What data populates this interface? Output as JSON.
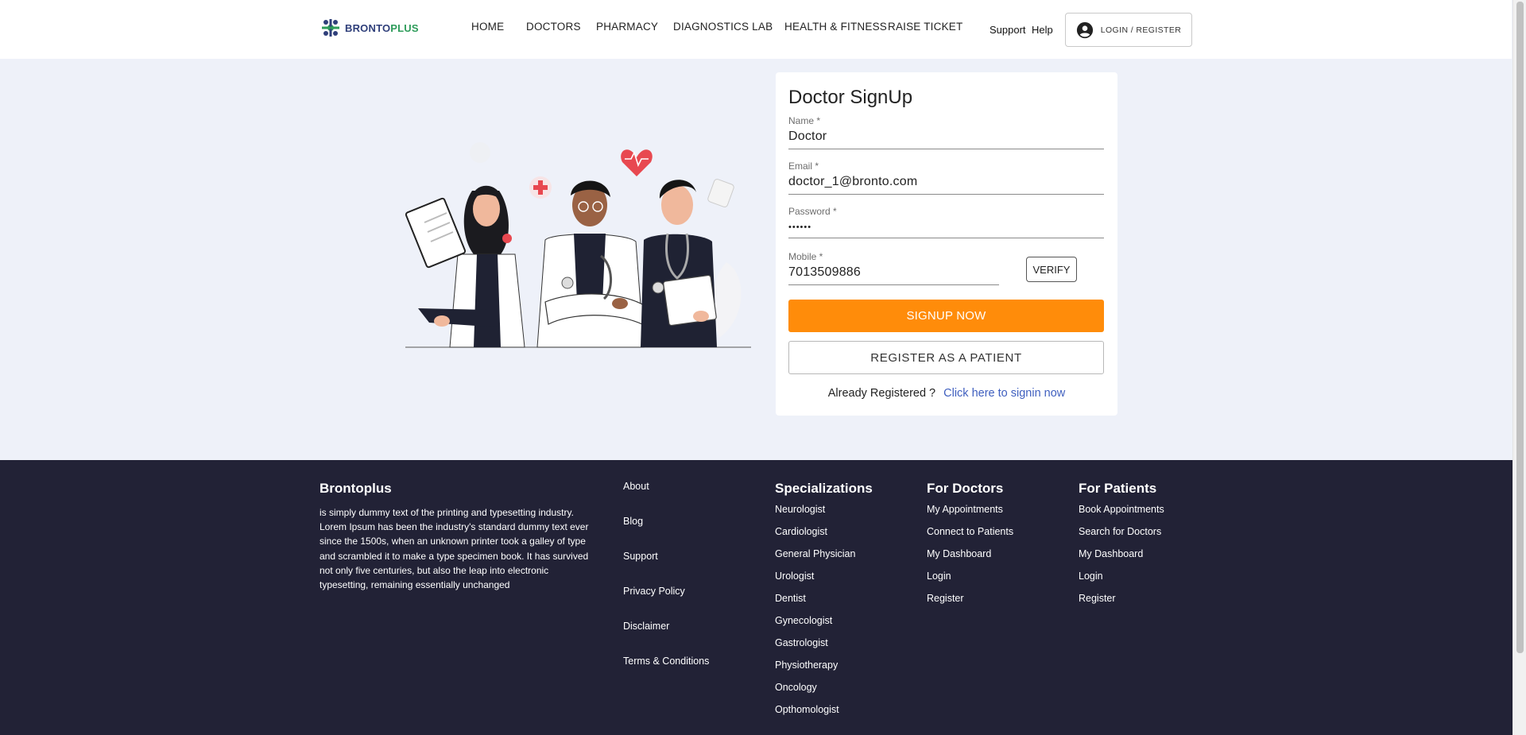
{
  "brand": {
    "part1": "BRONTO",
    "part2": "PLUS"
  },
  "nav": [
    "HOME",
    "DOCTORS",
    "PHARMACY",
    "DIAGNOSTICS LAB",
    "HEALTH & FITNESS",
    "RAISE TICKET"
  ],
  "top_links": {
    "support": "Support",
    "help": "Help"
  },
  "login_label": "LOGIN / REGISTER",
  "form": {
    "title": "Doctor SignUp",
    "name": {
      "label": "Name *",
      "value": "Doctor"
    },
    "email": {
      "label": "Email *",
      "value": "doctor_1@bronto.com"
    },
    "password": {
      "label": "Password *",
      "value": "••••••"
    },
    "mobile": {
      "label": "Mobile *",
      "value": "7013509886"
    },
    "verify_label": "VERIFY",
    "signup_label": "SIGNUP NOW",
    "patient_label": "REGISTER AS A PATIENT",
    "already_text": "Already Registered ?",
    "signin_link": "Click here to signin now"
  },
  "footer": {
    "brand": "Brontoplus",
    "description": "is simply dummy text of the printing and typesetting industry. Lorem Ipsum has been the industry's standard dummy text ever since the 1500s, when an unknown printer took a galley of type and scrambled it to make a type specimen book. It has survived not only five centuries, but also the leap into electronic typesetting, remaining essentially unchanged",
    "about_links": [
      "About",
      "Blog",
      "Support",
      "Privacy Policy",
      "Disclaimer",
      "Terms & Conditions"
    ],
    "specializations": {
      "title": "Specializations",
      "items": [
        "Neurologist",
        "Cardiologist",
        "General Physician",
        "Urologist",
        "Dentist",
        "Gynecologist",
        "Gastrologist",
        "Physiotherapy",
        "Oncology",
        "Opthomologist"
      ]
    },
    "for_doctors": {
      "title": "For Doctors",
      "items": [
        "My Appointments",
        "Connect to Patients",
        "My Dashboard",
        "Login",
        "Register"
      ]
    },
    "for_patients": {
      "title": "For Patients",
      "items": [
        "Book Appointments",
        "Search for Doctors",
        "My Dashboard",
        "Login",
        "Register"
      ]
    }
  },
  "colors": {
    "accent": "#ff8c0a",
    "footer_bg": "#222236",
    "page_bg": "#eef1f9",
    "link": "#3f5fbf"
  }
}
